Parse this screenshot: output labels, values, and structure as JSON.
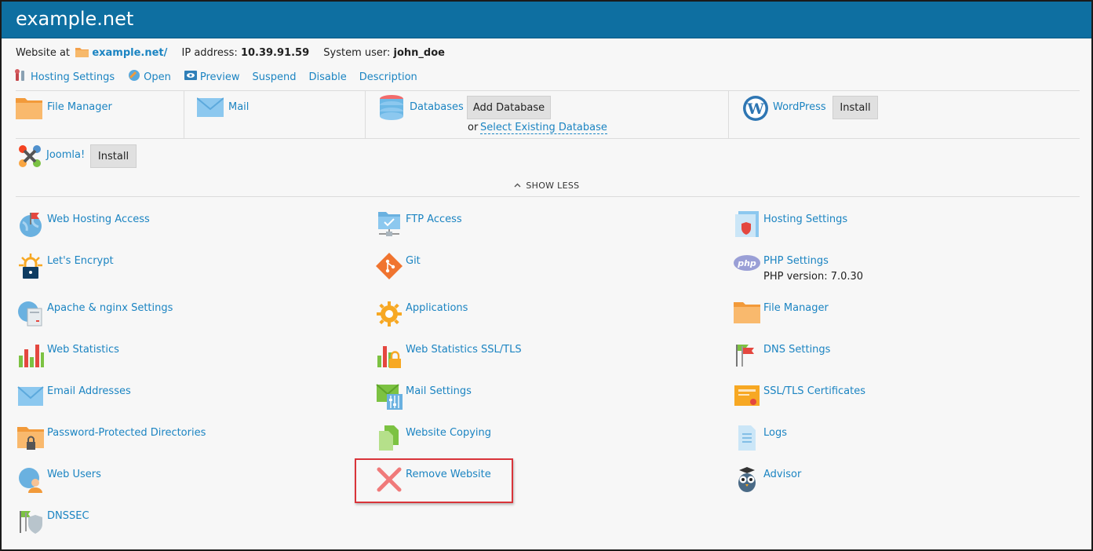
{
  "header": {
    "title": "example.net"
  },
  "info": {
    "website_at_label": "Website at",
    "website_link": "example.net/",
    "ip_label": "IP address:",
    "ip_value": "10.39.91.59",
    "sysuser_label": "System user:",
    "sysuser_value": "john_doe"
  },
  "topnav": [
    {
      "label": "Hosting Settings",
      "icon": "tools-icon"
    },
    {
      "label": "Open",
      "icon": "open-icon"
    },
    {
      "label": "Preview",
      "icon": "preview-icon"
    },
    {
      "label": "Suspend"
    },
    {
      "label": "Disable"
    },
    {
      "label": "Description"
    }
  ],
  "quick": {
    "file_manager": "File Manager",
    "mail": "Mail",
    "databases": "Databases",
    "add_database": "Add Database",
    "or": "or",
    "select_existing_db": "Select Existing Database",
    "wordpress": "WordPress",
    "wordpress_install": "Install",
    "joomla": "Joomla!",
    "joomla_install": "Install"
  },
  "show_less": "SHOW LESS",
  "tools": {
    "col1": [
      "Web Hosting Access",
      "Let's Encrypt",
      "Apache & nginx Settings",
      "Web Statistics",
      "Email Addresses",
      "Password-Protected Directories",
      "Web Users",
      "DNSSEC"
    ],
    "col2": [
      "FTP Access",
      "Git",
      "Applications",
      "Web Statistics SSL/TLS",
      "Mail Settings",
      "Website Copying",
      "Remove Website"
    ],
    "col3": [
      "Hosting Settings",
      "PHP Settings",
      "File Manager",
      "DNS Settings",
      "SSL/TLS Certificates",
      "Logs",
      "Advisor"
    ],
    "php_version": "PHP version: 7.0.30"
  },
  "colors": {
    "header": "#0e6fa1",
    "link": "#1b84c2",
    "highlight": "#d9343a"
  }
}
